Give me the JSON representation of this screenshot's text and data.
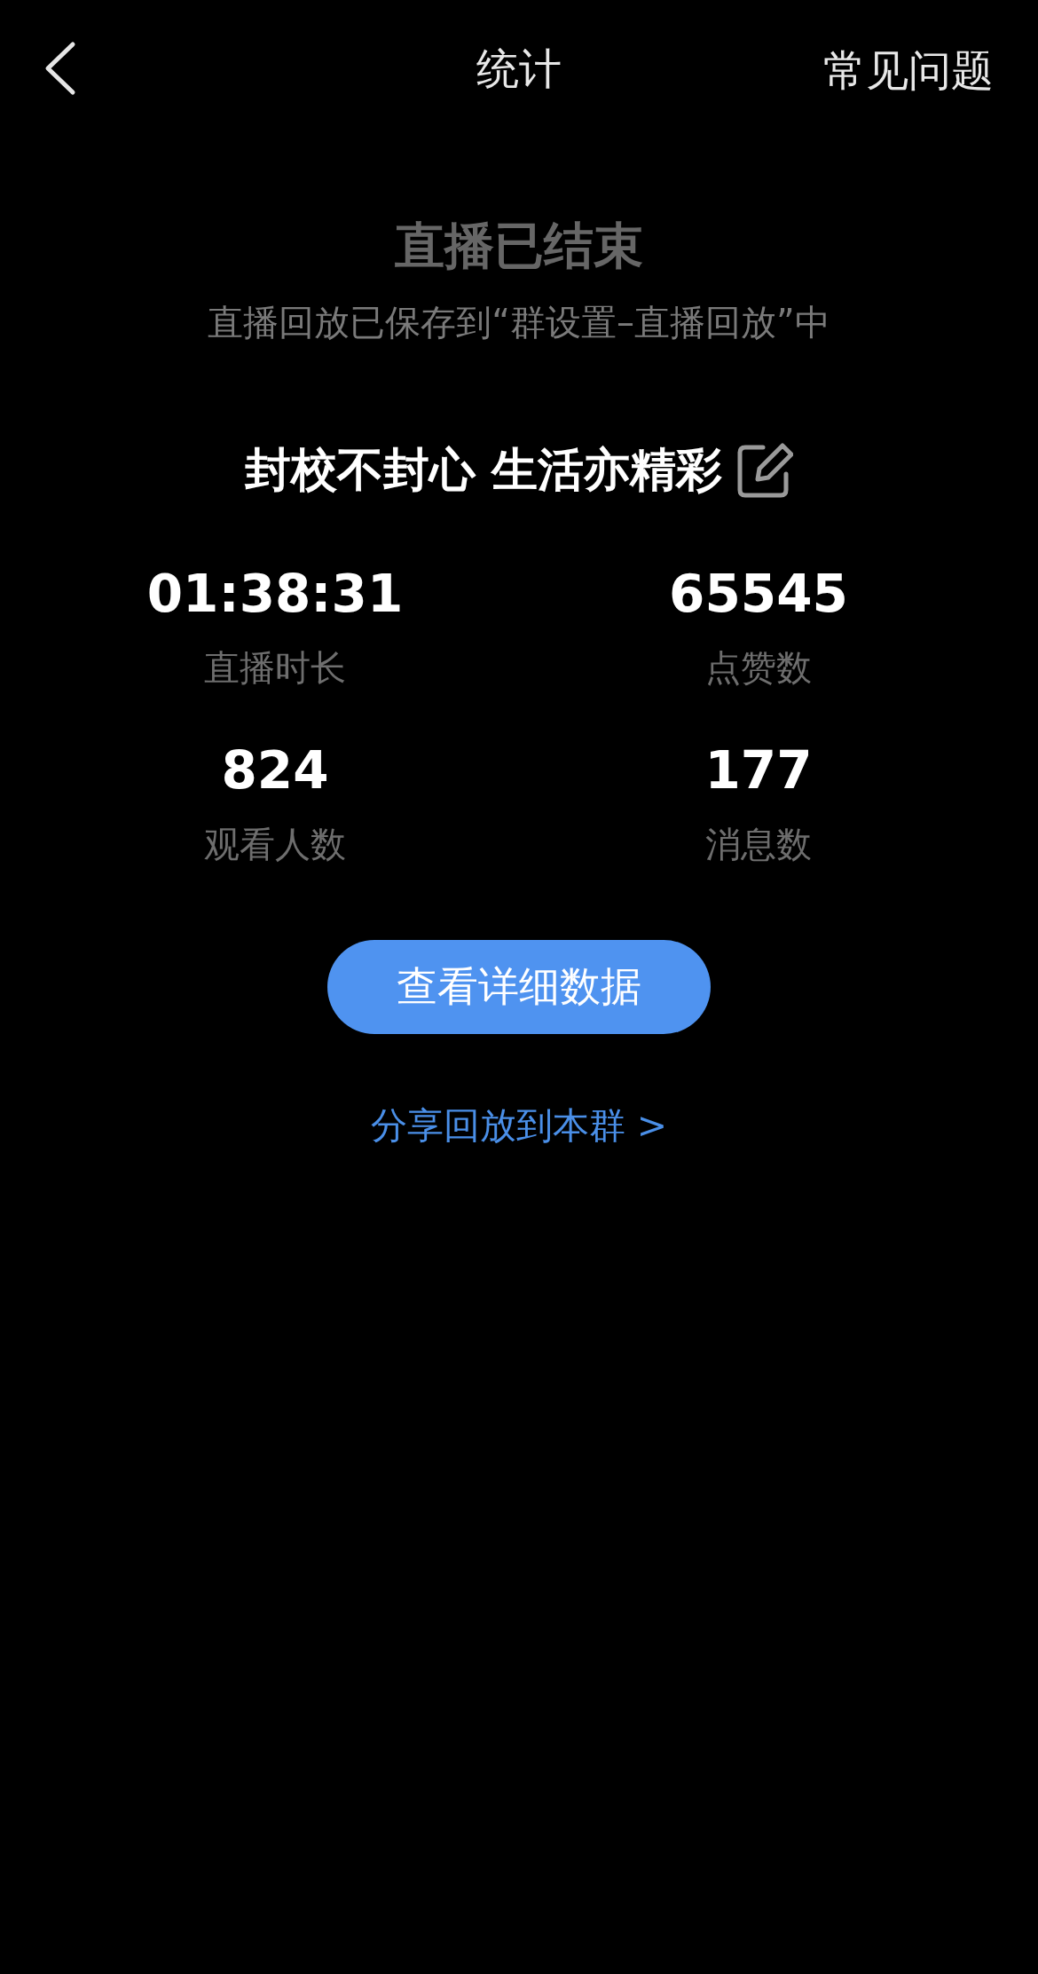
{
  "nav": {
    "title": "统计",
    "action": "常见问题"
  },
  "status": {
    "title": "直播已结束",
    "subtitle": "直播回放已保存到“群设置–直播回放”中"
  },
  "live_title": "封校不封心 生活亦精彩",
  "stats": [
    {
      "value": "01:38:31",
      "label": "直播时长"
    },
    {
      "value": "65545",
      "label": "点赞数"
    },
    {
      "value": "824",
      "label": "观看人数"
    },
    {
      "value": "177",
      "label": "消息数"
    }
  ],
  "detail_button": "查看详细数据",
  "share_link": "分享回放到本群 >"
}
